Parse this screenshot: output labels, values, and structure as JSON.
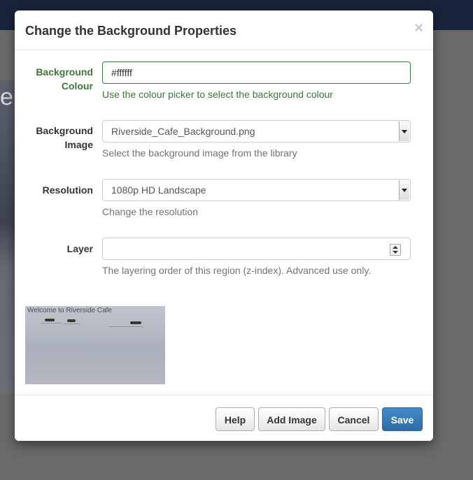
{
  "modal": {
    "title": "Change the Background Properties",
    "close_label": "×"
  },
  "form": {
    "background_colour": {
      "label": "Background Colour",
      "value": "#ffffff",
      "help": "Use the colour picker to select the background colour"
    },
    "background_image": {
      "label": "Background Image",
      "value": "Riverside_Cafe_Background.png",
      "help": "Select the background image from the library"
    },
    "resolution": {
      "label": "Resolution",
      "value": "1080p HD Landscape",
      "help": "Change the resolution"
    },
    "layer": {
      "label": "Layer",
      "value": "",
      "help": "The layering order of this region (z-index). Advanced use only."
    }
  },
  "preview": {
    "caption": "Welcome to Riverside Cafe"
  },
  "footer": {
    "help_label": "Help",
    "add_image_label": "Add Image",
    "cancel_label": "Cancel",
    "save_label": "Save"
  },
  "background_page": {
    "slide_letter": "e"
  },
  "colors": {
    "success": "#3c763d",
    "primary": "#337ab7",
    "topbar": "#17243b"
  }
}
